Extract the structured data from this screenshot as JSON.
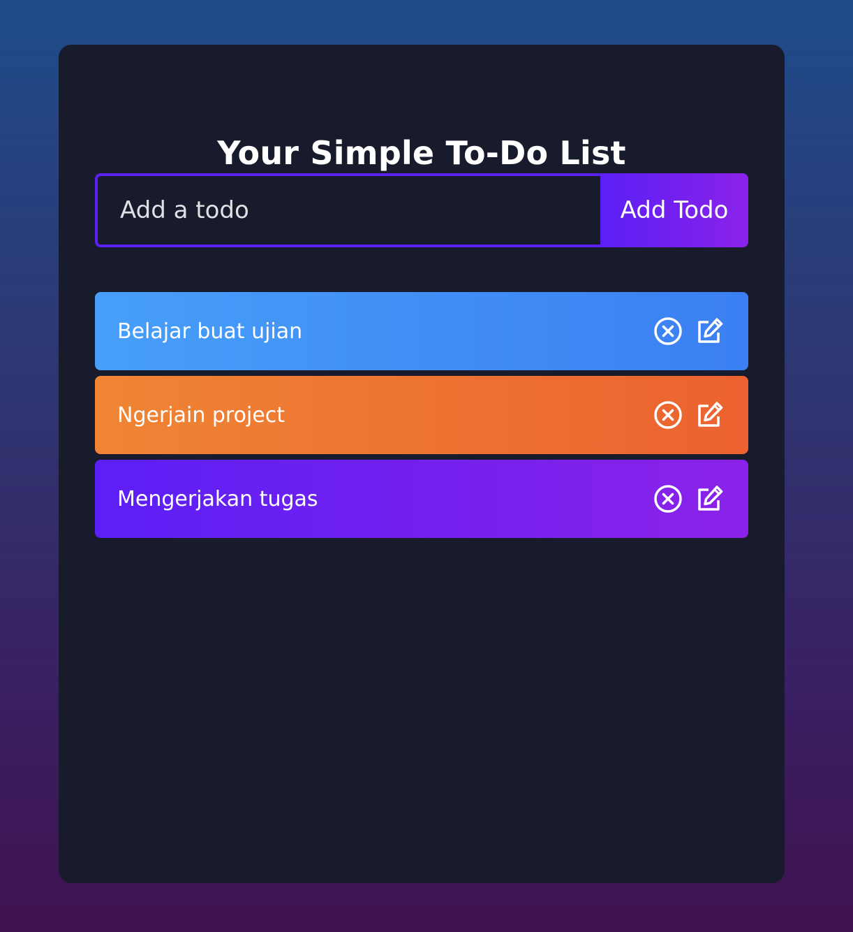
{
  "app": {
    "title": "Your Simple To-Do List"
  },
  "form": {
    "input_value": "",
    "input_placeholder": "Add a todo",
    "add_button_label": "Add Todo"
  },
  "todos": [
    {
      "text": "Belajar buat ujian",
      "color": "#479ff8",
      "delete_icon": "close-circle-icon",
      "edit_icon": "edit-icon"
    },
    {
      "text": "Ngerjain project",
      "color": "#ef8534",
      "delete_icon": "close-circle-icon",
      "edit_icon": "edit-icon"
    },
    {
      "text": "Mengerjakan tugas",
      "color": "#6a1ff3",
      "delete_icon": "close-circle-icon",
      "edit_icon": "edit-icon"
    }
  ],
  "colors": {
    "page_gradient_top": "#1f4b8a",
    "page_gradient_bottom": "#40124f",
    "card_background": "#181b2c",
    "accent": "#5b21f2"
  }
}
